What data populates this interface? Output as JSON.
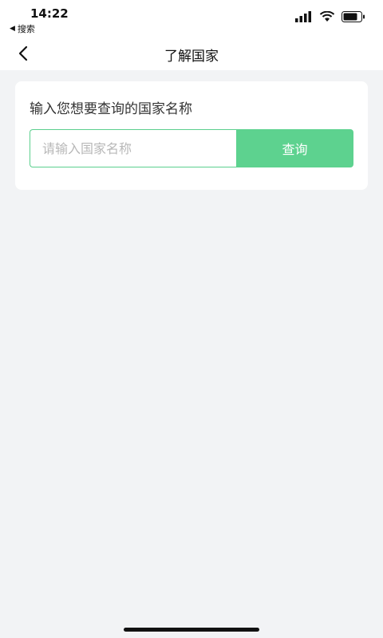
{
  "status_bar": {
    "time": "14:22",
    "back_app_label": "搜索",
    "icons": [
      "signal-icon",
      "wifi-icon",
      "battery-icon"
    ]
  },
  "nav": {
    "title": "了解国家",
    "back_icon": "chevron-left-icon"
  },
  "card": {
    "label": "输入您想要查询的国家名称",
    "search": {
      "placeholder": "请输入国家名称",
      "value": "",
      "button_label": "查询"
    }
  },
  "colors": {
    "accent": "#5dd28f",
    "background": "#f2f3f5",
    "card": "#ffffff"
  }
}
